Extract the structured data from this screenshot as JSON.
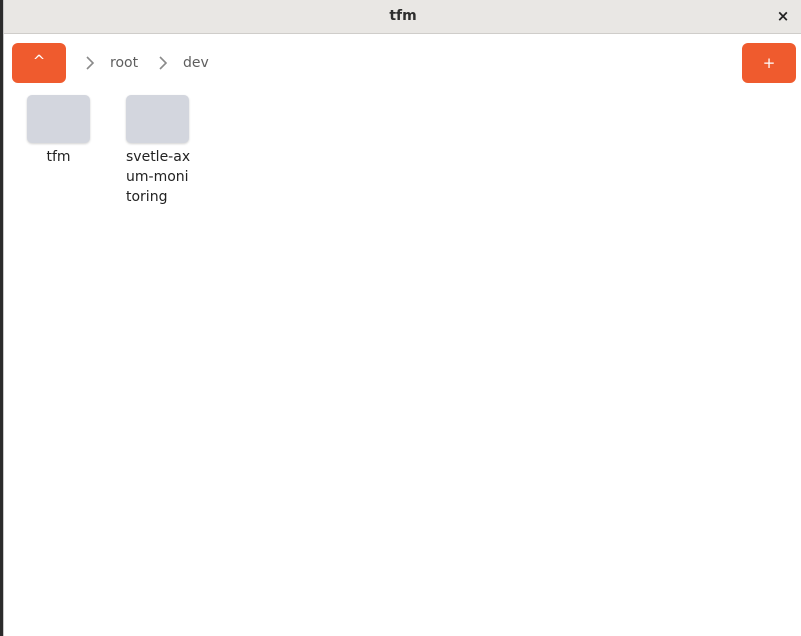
{
  "window": {
    "title": "tfm",
    "close_label": "×"
  },
  "toolbar": {
    "up_label": "^",
    "add_label": "+",
    "breadcrumbs": [
      "root",
      "dev"
    ]
  },
  "files": [
    {
      "name": "tfm",
      "type": "folder"
    },
    {
      "name": "svetle-axum-monitoring",
      "type": "folder"
    }
  ],
  "colors": {
    "accent": "#ef5b2e",
    "folder_thumb": "#d3d6de",
    "titlebar": "#e9e7e4"
  }
}
